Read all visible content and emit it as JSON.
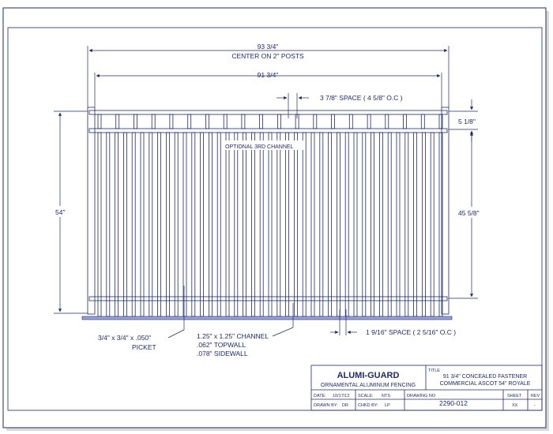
{
  "dimensions": {
    "overall_width": "93 3/4\"",
    "overall_width_note": "CENTER ON 2\" POSTS",
    "panel_width": "91 3/4\"",
    "top_space": "3 7/8\" SPACE ( 4 5/8\" O.C )",
    "top_rail_gap": "5 1/8\"",
    "height": "54\"",
    "picket_height": "45 5/8\"",
    "bottom_space": "1 9/16\" SPACE ( 2 5/16\" O.C )"
  },
  "callouts": {
    "optional_channel": "OPTIONAL 3RD CHANNEL",
    "picket_line1": "3/4\" x 3/4\" x .050\"",
    "picket_line2": "PICKET",
    "channel_line1": "1.25\" x 1.25\" CHANNEL",
    "channel_line2": ".062\" TOPWALL",
    "channel_line3": ".078\" SIDEWALL"
  },
  "title_block": {
    "company": "ALUMI-GUARD",
    "company_sub": "ORNAMENTAL ALUMINUM FENCING",
    "title_label": "TITLE",
    "title_line1": "91 3/4\" CONCEALED FASTENER",
    "title_line2": "COMMERCIAL ASCOT 54\" ROYALE",
    "date_label": "DATE:",
    "date_value": "10/17/12",
    "scale_label": "SCALE:",
    "scale_value": "NTS",
    "drawing_no_label": "DRAWING NO",
    "drawing_no_value": "2290-012",
    "drawn_by_label": "DRAWN BY:",
    "drawn_by_value": "DR",
    "chkd_by_label": "CHKD BY:",
    "chkd_by_value": "LP",
    "sheet_label": "SHEET",
    "sheet_value": "XX",
    "rev_label": "REV",
    "rev_value": "-"
  },
  "colors": {
    "line": "#1f2a6b",
    "ground": "#9aa3d6"
  }
}
